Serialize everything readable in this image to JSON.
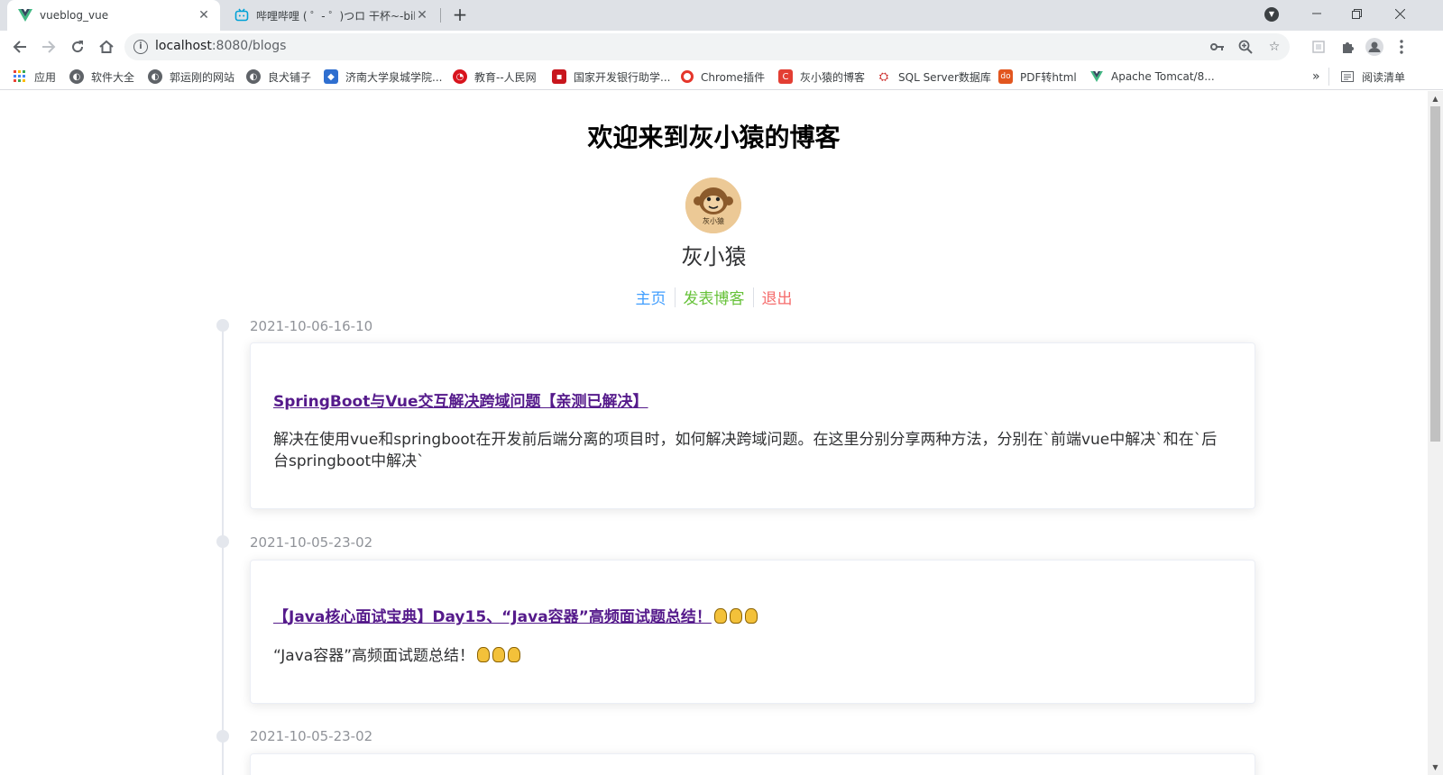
{
  "browser": {
    "tabs": [
      {
        "title": "vueblog_vue",
        "active": true
      },
      {
        "title": "哔哩哔哩 ( ゜- ゜)つロ 干杯~-bilibili",
        "active": false
      }
    ],
    "new_tab": "+",
    "url_host": "localhost",
    "url_rest": ":8080/blogs",
    "bookmarks": [
      {
        "label": "应用",
        "icon": "apps-grid-icon"
      },
      {
        "label": "软件大全",
        "icon": "globe-icon"
      },
      {
        "label": "郭运刚的网站",
        "icon": "globe-icon"
      },
      {
        "label": "良犬铺子",
        "icon": "globe-icon"
      },
      {
        "label": "济南大学泉城学院...",
        "icon": "school-icon"
      },
      {
        "label": "教育--人民网",
        "icon": "people-daily-icon"
      },
      {
        "label": "国家开发银行助学...",
        "icon": "bank-icon"
      },
      {
        "label": "Chrome插件",
        "icon": "chrome-icon"
      },
      {
        "label": "灰小猿的博客",
        "icon": "csdn-icon"
      },
      {
        "label": "SQL Server数据库",
        "icon": "sqlserver-icon"
      },
      {
        "label": "PDF转html",
        "icon": "pdf-icon"
      },
      {
        "label": "Apache Tomcat/8...",
        "icon": "vue-icon"
      }
    ],
    "more_bookmarks": "»",
    "reading_list": "阅读清单"
  },
  "page": {
    "site_title": "欢迎来到灰小猿的博客",
    "avatar_text": "灰小猿",
    "username": "灰小猿",
    "nav": [
      {
        "label": "主页",
        "color": "#409EFF"
      },
      {
        "label": "发表博客",
        "color": "#67C23A"
      },
      {
        "label": "退出",
        "color": "#F56C6C"
      }
    ],
    "blogs": [
      {
        "time": "2021-10-06-16-10",
        "title": "SpringBoot与Vue交互解决跨域问题【亲测已解决】",
        "description": "解决在使用vue和springboot在开发前后端分离的项目时，如何解决跨域问题。在这里分别分享两种方法，分别在`前端vue中解决`和在`后台springboot中解决`",
        "emoji_count": 0
      },
      {
        "time": "2021-10-05-23-02",
        "title": "【Java核心面试宝典】Day15、“Java容器”高频面试题总结！",
        "description": "“Java容器”高频面试题总结！",
        "emoji_count": 3
      },
      {
        "time": "2021-10-05-23-02"
      }
    ]
  }
}
